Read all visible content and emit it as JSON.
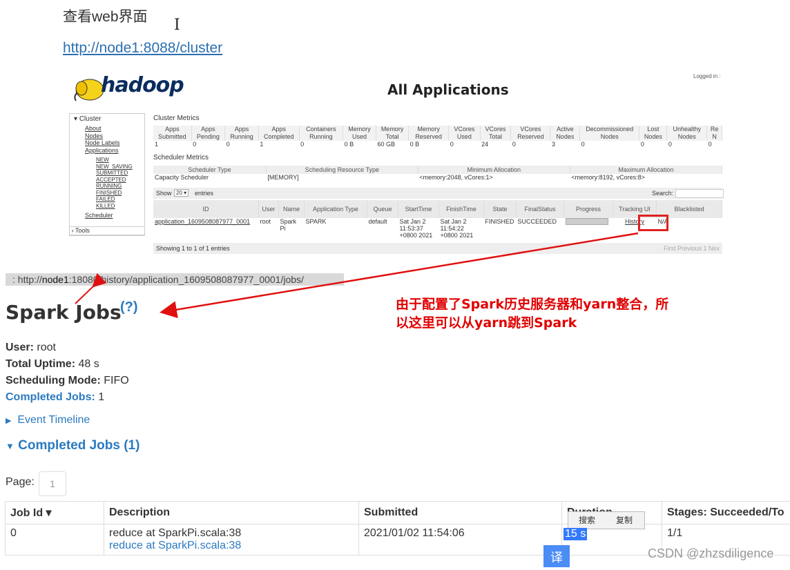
{
  "doc": {
    "heading": "查看web界面",
    "cluster_link": "http://node1:8088/cluster"
  },
  "hadoop": {
    "logo_text": "hadoop",
    "title": "All Applications",
    "logged_in": "Logged in :",
    "nav": {
      "cluster": "Cluster",
      "links": [
        "About",
        "Nodes",
        "Node Labels",
        "Applications"
      ],
      "app_states": [
        "NEW",
        "NEW_SAVING",
        "SUBMITTED",
        "ACCEPTED",
        "RUNNING",
        "FINISHED",
        "FAILED",
        "KILLED"
      ],
      "scheduler": "Scheduler",
      "tools": "Tools"
    },
    "cluster_metrics_label": "Cluster Metrics",
    "cluster_metrics_headers": [
      "Apps Submitted",
      "Apps Pending",
      "Apps Running",
      "Apps Completed",
      "Containers Running",
      "Memory Used",
      "Memory Total",
      "Memory Reserved",
      "VCores Used",
      "VCores Total",
      "VCores Reserved",
      "Active Nodes",
      "Decommissioned Nodes",
      "Lost Nodes",
      "Unhealthy Nodes",
      "Re N"
    ],
    "cluster_metrics_values": [
      "1",
      "0",
      "0",
      "1",
      "0",
      "0 B",
      "60 GB",
      "0 B",
      "0",
      "24",
      "0",
      "3",
      "0",
      "0",
      "0",
      "0"
    ],
    "scheduler_metrics_label": "Scheduler Metrics",
    "scheduler_headers": [
      "Scheduler Type",
      "Scheduling Resource Type",
      "Minimum Allocation",
      "Maximum Allocation"
    ],
    "scheduler_values": [
      "Capacity Scheduler",
      "[MEMORY]",
      "<memory:2048, vCores:1>",
      "<memory:8192, vCores:8>"
    ],
    "show_label": "Show",
    "show_value": "20",
    "entries_label": "entries",
    "search_label": "Search:",
    "app_headers": [
      "ID",
      "User",
      "Name",
      "Application Type",
      "Queue",
      "StartTime",
      "FinishTime",
      "State",
      "FinalStatus",
      "Progress",
      "Tracking UI",
      "Blacklisted"
    ],
    "app_row": {
      "id": "application_1609508087977_0001",
      "user": "root",
      "name": "Spark Pi",
      "type": "SPARK",
      "queue": "default",
      "start": "Sat Jan 2 11:53:37 +0800 2021",
      "finish": "Sat Jan 2 11:54:22 +0800 2021",
      "state": "FINISHED",
      "final_status": "SUCCEEDED",
      "tracking": "History",
      "blacklisted": "N/A"
    },
    "footer": "Showing 1 to 1 of 1 entries",
    "pager": "First  Previous  1  Nex"
  },
  "spark": {
    "url_prefix": ": http://",
    "url_host": "node1",
    "url_rest": ":18080/history/application_1609508087977_0001/jobs/",
    "title": "Spark Jobs",
    "help": "(?)",
    "user_label": "User:",
    "user": "root",
    "uptime_label": "Total Uptime:",
    "uptime": "48 s",
    "mode_label": "Scheduling Mode:",
    "mode": "FIFO",
    "completed_label": "Completed Jobs:",
    "completed": "1",
    "event_timeline": "Event Timeline",
    "completed_section": "Completed Jobs (1)",
    "page_label": "Page:",
    "page_value": "1",
    "table_headers": [
      "Job Id ▾",
      "Description",
      "Submitted",
      "Duration",
      "Stages: Succeeded/To"
    ],
    "row": {
      "id": "0",
      "desc1": "reduce at SparkPi.scala:38",
      "desc2": "reduce at SparkPi.scala:38",
      "submitted": "2021/01/02 11:54:06",
      "duration": "15 s",
      "stages": "1/1"
    }
  },
  "annotation": {
    "line1": "由于配置了Spark历史服务器和yarn整合，所",
    "line2": "以这里可以从yarn跳到Spark"
  },
  "popup": {
    "search": "搜索",
    "copy": "复制"
  },
  "translate_button": "译",
  "watermark": "CSDN @zhzsdiligence",
  "colors": {
    "arrow": "#e01010",
    "link": "#2a7ac0"
  }
}
